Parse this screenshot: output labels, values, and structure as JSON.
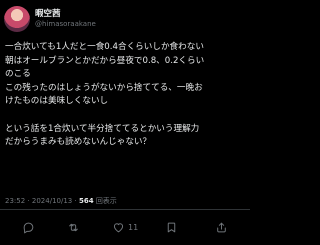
{
  "post": {
    "author": {
      "display_name": "暇空茜",
      "handle": "@himasoraakane"
    },
    "text_lines": [
      "一合炊いても1人だと一食0.4合くらいしか食わない",
      "朝はオールブランとかだから昼夜で0.8、0.2くらい",
      "のこる",
      "この残ったのはしょうがないから捨ててる、一晩お",
      "けたものは美味しくないし",
      "",
      "という話を1合炊いて半分捨ててるとかいう理解力",
      "だからうまみも読めないんじゃない？"
    ],
    "meta": {
      "time": "23:52",
      "separator": "·",
      "date": "2024/10/13",
      "views_count": "564",
      "views_label": "回表示"
    },
    "actions": {
      "reply_icon": "reply-icon",
      "repost_icon": "repost-icon",
      "like_icon": "heart-icon",
      "like_count": "11",
      "bookmark_icon": "bookmark-icon",
      "share_icon": "share-icon"
    }
  },
  "colors": {
    "background": "#000000",
    "text": "#e7e9ea",
    "secondary": "#71767b",
    "divider": "#2f3336"
  }
}
